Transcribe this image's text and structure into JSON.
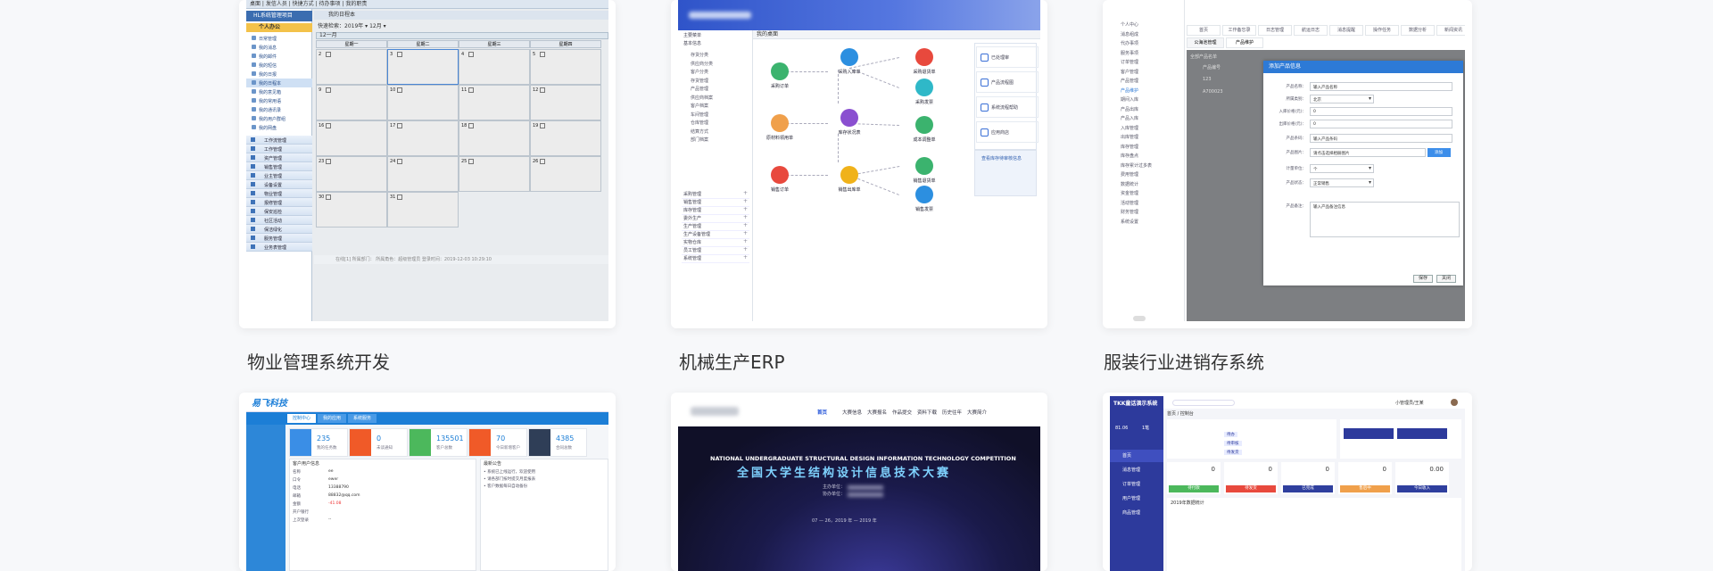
{
  "projects": [
    {
      "title": "物业管理系统开发"
    },
    {
      "title": "机械生产ERP"
    },
    {
      "title": "服装行业进销存系统"
    }
  ],
  "shot1": {
    "toolbar": "桌面 | 发信人员 | 快捷方式 | 待办事项 | 我的职责",
    "tab": "我的日程本",
    "app_title": "HL系统管理项目",
    "menu_section": "个人办公",
    "menu_items": [
      "日常管理",
      "我的消息",
      "我的邮件",
      "我的短信",
      "我的日报",
      "我的日程本",
      "我的意见箱",
      "我的常用语",
      "我的通讯录",
      "我的用户群组",
      "我的网盘"
    ],
    "group_items": [
      "工作流管理",
      "工作管理",
      "资产管理",
      "销售管理",
      "业主管理",
      "设备设置",
      "物业管理",
      "报修管理",
      "保安巡检",
      "社区活动",
      "保洁绿化",
      "服务管理",
      "业务表管理"
    ],
    "filter": "快速检索：2019年 ▾  12月 ▾",
    "month_label": "12一月",
    "weekdays": [
      "星期一",
      "星期二",
      "星期三",
      "星期四"
    ],
    "days": [
      "2",
      "3",
      "4",
      "5",
      "9",
      "10",
      "11",
      "12",
      "16",
      "17",
      "18",
      "19",
      "23",
      "24",
      "25",
      "26",
      "30",
      "31"
    ],
    "status": "在线[1]  所属部门：  所属角色：超级管理员  登录时间：2019-12-03 10:29:10"
  },
  "shot2": {
    "tab": "我的桌面",
    "left_top": [
      "主要菜单",
      "基本信息"
    ],
    "left_items": [
      "存货分类",
      "供应商分类",
      "客户分类",
      "存货管理",
      "产品管理",
      "供应商档案",
      "客户档案",
      "车间管理",
      "仓库管理",
      "结算方式",
      "部门档案"
    ],
    "left_bottom": [
      "采购管理",
      "销售管理",
      "库存管理",
      "委外生产",
      "生产管理",
      "生产设备管理",
      "实物仓库",
      "员工管理",
      "系统管理"
    ],
    "nodes": [
      "采购订单",
      "采购入库单",
      "采购退货单",
      "采购发票",
      "原材料领用单",
      "库存状况表",
      "成本调整单",
      "销售订单",
      "销售出库单",
      "销售退货单",
      "销售发票"
    ],
    "shortcuts": [
      "已处理审",
      "产品流程图",
      "系统流程帮助",
      "应用商店",
      "查看库存待审核信息"
    ]
  },
  "shot3": {
    "side_items": [
      "个人中心",
      "消息组成",
      "代办事项",
      "服务事项",
      "订单管理",
      "客户管理",
      "产品管理",
      "产品维护",
      "期间入库",
      "产品出库",
      "产品入库",
      "入库管理",
      "出库管理",
      "库存管理",
      "库存盘点",
      "库存累计过多表",
      "费用管理",
      "数据统计",
      "资金管理",
      "活动管理",
      "财务管理",
      "系统设置"
    ],
    "top_tabs": [
      "首页",
      "工作备忘录",
      "日志管理",
      "航运日志",
      "消息提醒",
      "操作任务",
      "数据分析",
      "新闻资讯"
    ],
    "sub_tabs": [
      "公海池管理",
      "产品维护"
    ],
    "list_title": "全部产品名单",
    "list_rows": [
      "产品编号",
      "123",
      "A700023"
    ],
    "dialog_title": "添加产品信息",
    "fields": [
      {
        "label": "产品名称：",
        "value": "输入产品名称"
      },
      {
        "label": "所属类别：",
        "value": "北京"
      },
      {
        "label": "入库价格(元)：",
        "value": "0"
      },
      {
        "label": "出库价格(元)：",
        "value": "0"
      },
      {
        "label": "产品条码：",
        "value": "输入产品条码"
      },
      {
        "label": "产品图片：",
        "value": "请点击选择相册图片"
      },
      {
        "label": "计量单位：",
        "value": "个"
      },
      {
        "label": "产品状态：",
        "value": "正常销售"
      },
      {
        "label": "产品备注：",
        "value": "输入产品备注信息"
      }
    ],
    "add_btn": "添加",
    "save_btn": "保存",
    "cancel_btn": "关闭"
  },
  "shot4": {
    "logo": "易飞科技",
    "tabs": [
      "控制中心",
      "我的应用",
      "系统服务"
    ],
    "stats": [
      {
        "value": "235",
        "label": "我的任务数",
        "color": "#3a8ee6"
      },
      {
        "value": "0",
        "label": "未读通知",
        "color": "#f05a28"
      },
      {
        "value": "135501",
        "label": "客户总数",
        "color": "#4cb85c"
      },
      {
        "value": "70",
        "label": "今日新增客户",
        "color": "#f05a28"
      },
      {
        "value": "4385",
        "label": "合同总数",
        "color": "#2f3e57"
      }
    ],
    "panel_title": "客户用户信息",
    "info_rows": [
      [
        "名称",
        "ee"
      ],
      [
        "口令",
        "ewer"
      ],
      [
        "电话",
        "13388790"
      ],
      [
        "邮箱",
        "88832@qq.com"
      ],
      [
        "金额",
        "-41.08"
      ],
      [
        "开户银行",
        ""
      ],
      [
        "上次登录",
        "--"
      ]
    ],
    "notice_title": "最新公告",
    "notices": [
      "• 系统已上线运行，欢迎使用",
      "• 请各部门按时提交月度报表",
      "• 客户数据每日自动备份"
    ]
  },
  "shot5": {
    "nav": [
      "首页",
      "大赛信息",
      "大赛报名",
      "作品提交",
      "资料下载",
      "历史往年",
      "大赛简介"
    ],
    "banner_en": "NATIONAL UNDERGRADUATE STRUCTURAL DESIGN INFORMATION TECHNOLOGY COMPETITION",
    "banner_cn": "全国大学生结构设计信息技术大赛",
    "line1": "主办单位：",
    "line2": "协办单位：",
    "date": "07 — 26，2019 年 — 2019 年"
  },
  "shot6": {
    "logo": "TKK童话演示系统",
    "side_nums": [
      "81.06",
      "1笔"
    ],
    "side_items": [
      "首页",
      "消息管理",
      "订单管理",
      "用户管理",
      "商品管理"
    ],
    "breadcrumb": "首页 / 控制台",
    "user": "小管理员/王某",
    "tags": [
      "待办",
      "待审核",
      "待发货"
    ],
    "tiles": [
      {
        "value": "0",
        "label": "待付款",
        "color": "#4cb85c"
      },
      {
        "value": "0",
        "label": "待发货",
        "color": "#e8493d"
      },
      {
        "value": "0",
        "label": "已完成",
        "color": "#2f3f9e"
      },
      {
        "value": "0",
        "label": "售后中",
        "color": "#f0a04b"
      },
      {
        "value": "0.00",
        "label": "今日收入",
        "color": "#2f3f9e"
      }
    ],
    "footer": "2019年数据统计"
  }
}
